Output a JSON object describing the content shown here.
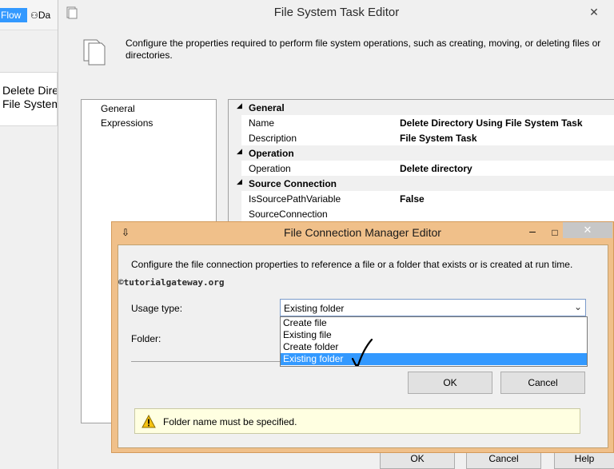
{
  "background": {
    "flow_tab": "Flow",
    "data_tab": "Da",
    "task_box_line1": "Delete Direc",
    "task_box_line2": "File System"
  },
  "main_window": {
    "title": "File System Task Editor",
    "close_glyph": "✕",
    "description": "Configure the properties required to perform file system operations, such as creating, moving, or deleting files or directories.",
    "nav_items": [
      "General",
      "Expressions"
    ],
    "properties": {
      "general_category": "General",
      "name_label": "Name",
      "name_value": "Delete Directory Using File System Task",
      "description_label": "Description",
      "description_value": "File System Task",
      "operation_category": "Operation",
      "operation_label": "Operation",
      "operation_value": "Delete directory",
      "source_category": "Source Connection",
      "is_source_var_label": "IsSourcePathVariable",
      "is_source_var_value": "False",
      "source_connection_label": "SourceConnection",
      "collapse_glyph": "◢"
    },
    "buttons": {
      "ok": "OK",
      "cancel": "Cancel",
      "help": "Help"
    }
  },
  "dialog": {
    "title": "File Connection Manager Editor",
    "icon_glyph": "⇩",
    "minimize_glyph": "–",
    "maximize_glyph": "□",
    "close_glyph": "✕",
    "description": "Configure the file connection properties to reference a file or a folder that exists or is created at run time.",
    "watermark": "©tutorialgateway.org",
    "usage_label": "Usage type:",
    "usage_selected": "Existing folder",
    "usage_options": [
      "Create file",
      "Existing file",
      "Create folder",
      "Existing folder"
    ],
    "selected_option_index": 3,
    "dropdown_arrow": "⌄",
    "folder_label": "Folder:",
    "ok": "OK",
    "cancel": "Cancel",
    "warning": "Folder name must be specified."
  },
  "colors": {
    "dialog_frame": "#f0c08a",
    "selection": "#3399ff",
    "warning_bg": "#ffffe1"
  }
}
